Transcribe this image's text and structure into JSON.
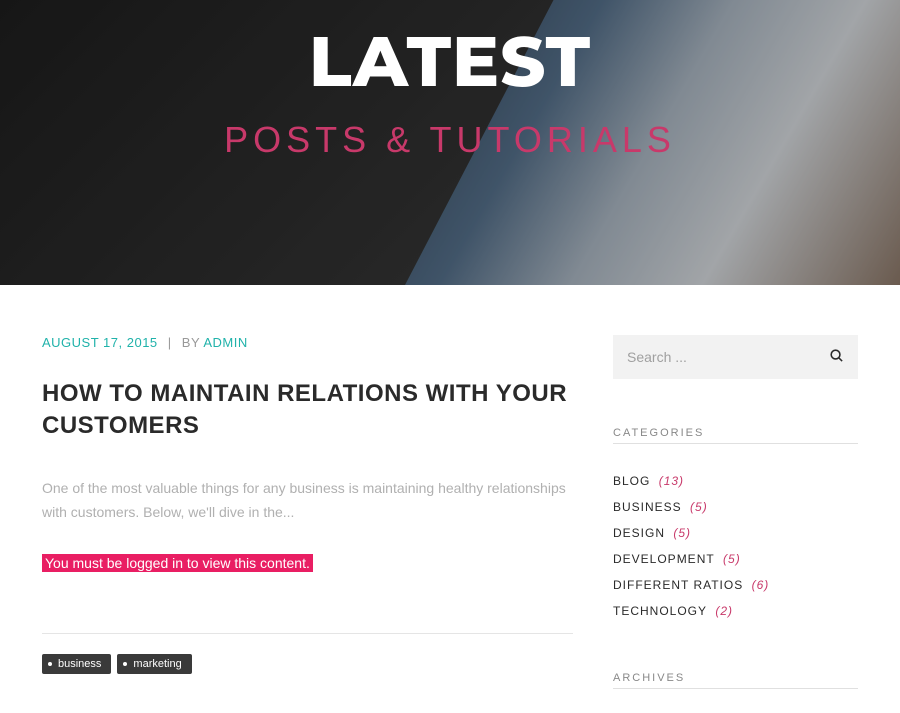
{
  "hero": {
    "title": "LATEST",
    "subtitle": "POSTS & TUTORIALS"
  },
  "post": {
    "date": "AUGUST 17, 2015",
    "by_label": "BY",
    "author": "ADMIN",
    "title": "HOW TO MAINTAIN RELATIONS WITH YOUR CUSTOMERS",
    "excerpt": "One of the most valuable things for any business is maintaining healthy relationships with customers. Below, we'll dive in the...",
    "login_notice": "You must be logged in to view this content."
  },
  "tags": [
    "business",
    "marketing"
  ],
  "search": {
    "placeholder": "Search ..."
  },
  "widgets": {
    "categories_title": "CATEGORIES",
    "archives_title": "ARCHIVES"
  },
  "categories": [
    {
      "name": "BLOG",
      "count": "(13)"
    },
    {
      "name": "BUSINESS",
      "count": "(5)"
    },
    {
      "name": "DESIGN",
      "count": "(5)"
    },
    {
      "name": "DEVELOPMENT",
      "count": "(5)"
    },
    {
      "name": "DIFFERENT RATIOS",
      "count": "(6)"
    },
    {
      "name": "TECHNOLOGY",
      "count": "(2)"
    }
  ]
}
